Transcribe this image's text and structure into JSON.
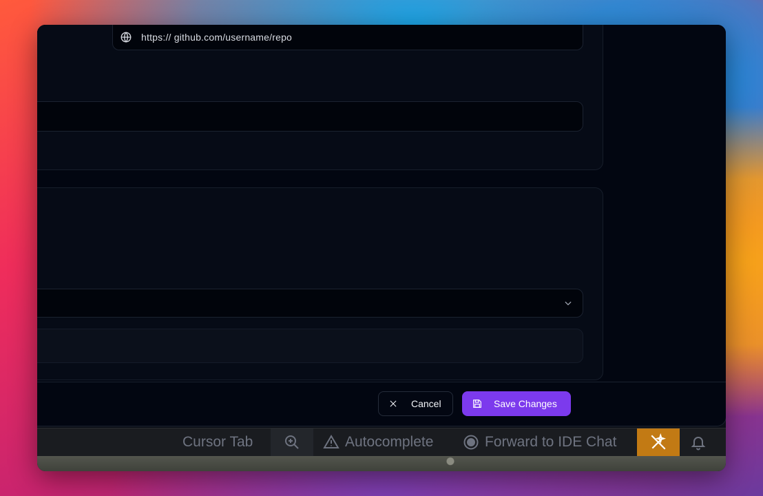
{
  "url_field": {
    "value": "https:// github.com/username/repo",
    "icon": "globe-icon"
  },
  "select_field": {
    "icon": "chevron-down-icon",
    "value": ""
  },
  "footer": {
    "cancel_label": "Cancel",
    "cancel_icon": "close-icon",
    "save_label": "Save Changes",
    "save_icon": "save-icon"
  },
  "status_bar": {
    "cursor_tab": "Cursor Tab",
    "zoom_icon": "zoom-in-icon",
    "autocomplete": "Autocomplete",
    "autocomplete_icon": "warning-icon",
    "forward_chat": "Forward to IDE Chat",
    "forward_icon": "record-icon",
    "magic_icon": "wand-off-icon",
    "bell_icon": "bell-icon"
  },
  "colors": {
    "accent": "#7c3aed",
    "dialog_bg": "#020611",
    "highlight": "#c27a14"
  }
}
